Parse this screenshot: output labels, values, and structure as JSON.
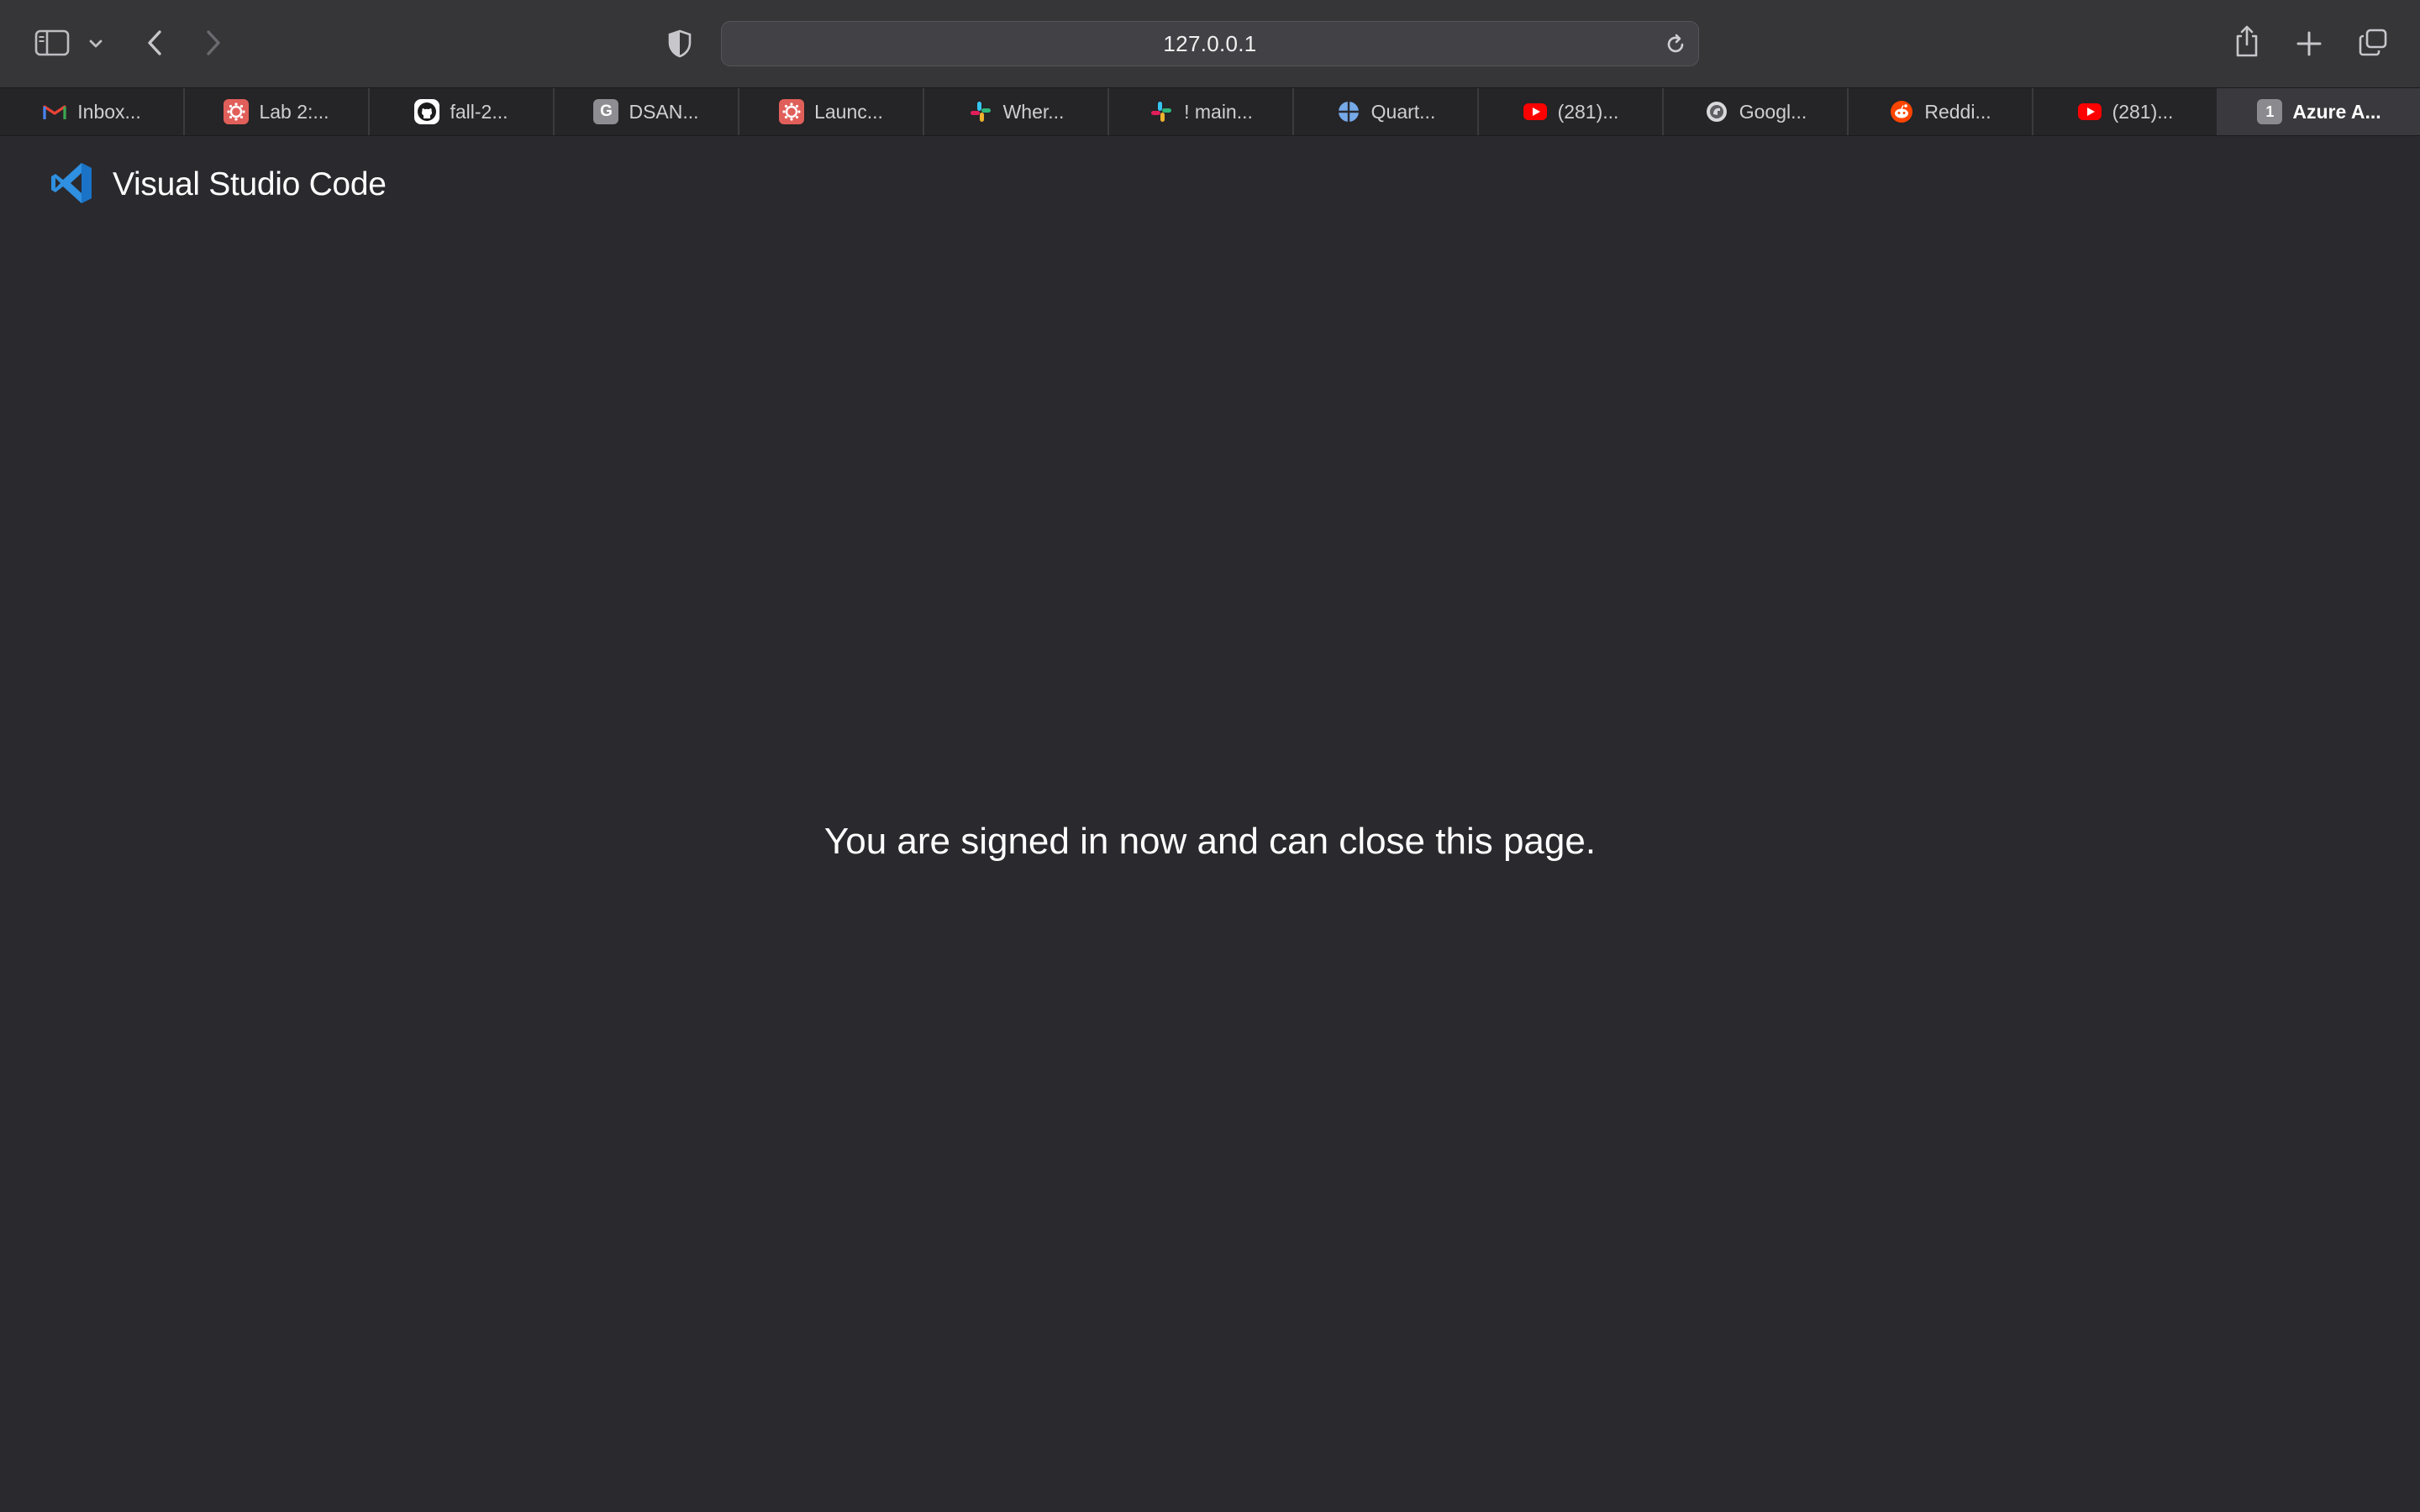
{
  "browser": {
    "address": "127.0.0.1",
    "tabs": [
      {
        "label": "Inbox...",
        "icon": "gmail-icon"
      },
      {
        "label": "Lab 2:...",
        "icon": "canvas-icon"
      },
      {
        "label": "fall-2...",
        "icon": "github-icon"
      },
      {
        "label": "DSAN...",
        "icon": "g-letter-icon",
        "icon_text": "G"
      },
      {
        "label": "Launc...",
        "icon": "canvas-icon"
      },
      {
        "label": "Wher...",
        "icon": "slack-icon"
      },
      {
        "label": "! main...",
        "icon": "slack-icon"
      },
      {
        "label": "Quart...",
        "icon": "globe-icon"
      },
      {
        "label": "(281)...",
        "icon": "youtube-icon"
      },
      {
        "label": "Googl...",
        "icon": "chrome-dino-icon"
      },
      {
        "label": "Reddi...",
        "icon": "reddit-icon"
      },
      {
        "label": "(281)...",
        "icon": "youtube-icon"
      },
      {
        "label": "Azure A...",
        "icon": "number-badge-icon",
        "icon_text": "1",
        "active": true
      }
    ]
  },
  "page": {
    "brand_title": "Visual Studio Code",
    "message": "You are signed in now and can close this page."
  },
  "colors": {
    "page_background": "#2a292e",
    "toolbar_background": "#363538",
    "vscode_blue": "#2f8fe0"
  }
}
